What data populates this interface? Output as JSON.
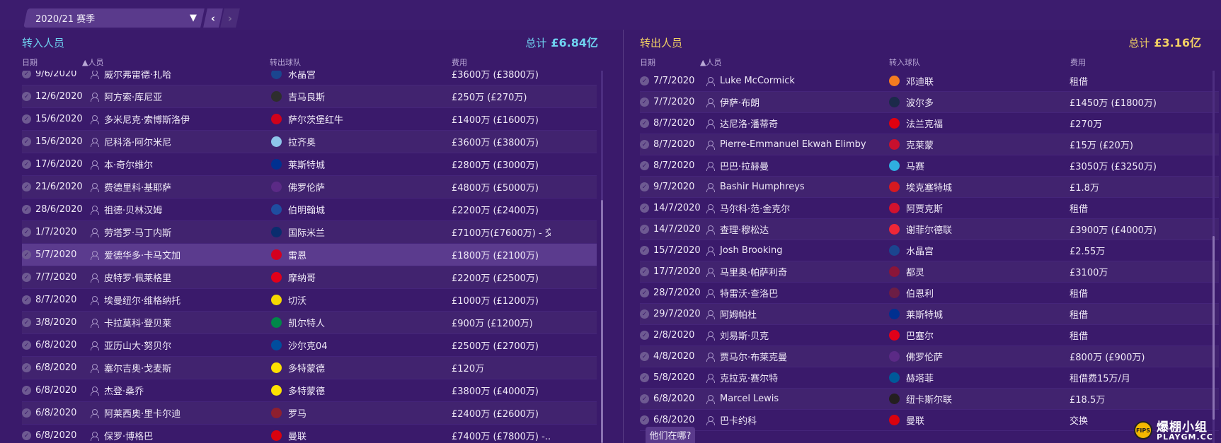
{
  "season": {
    "label": "2020/21 赛季"
  },
  "incoming": {
    "title": "转入人员",
    "total_label": "总计",
    "total_value": "£6.84亿",
    "columns": [
      "日期",
      "▲人员",
      "转出球队",
      "费用"
    ],
    "rows": [
      {
        "date": "9/6/2020",
        "person": "威尔弗雷德·扎哈",
        "club": "水晶宫",
        "fee": "£3600万 (£3800万)",
        "badge_color": "#1b458f"
      },
      {
        "date": "12/6/2020",
        "person": "阿方索·库尼亚",
        "club": "吉马良斯",
        "fee": "£250万 (£270万)",
        "badge_color": "#2e2e2e"
      },
      {
        "date": "15/6/2020",
        "person": "多米尼克·索博斯洛伊",
        "club": "萨尔茨堡红牛",
        "fee": "£1400万 (£1600万)",
        "badge_color": "#d0021b"
      },
      {
        "date": "15/6/2020",
        "person": "尼科洛·阿尔米尼",
        "club": "拉齐奥",
        "fee": "£3600万 (£3800万)",
        "badge_color": "#8ec5ea"
      },
      {
        "date": "17/6/2020",
        "person": "本·奇尔维尔",
        "club": "莱斯特城",
        "fee": "£2800万 (£3000万)",
        "badge_color": "#003090"
      },
      {
        "date": "21/6/2020",
        "person": "费德里科·基耶萨",
        "club": "佛罗伦萨",
        "fee": "£4800万 (£5000万)",
        "badge_color": "#5b2a86"
      },
      {
        "date": "28/6/2020",
        "person": "祖德·贝林汉姆",
        "club": "伯明翰城",
        "fee": "£2200万 (£2400万)",
        "badge_color": "#1f4da0"
      },
      {
        "date": "1/7/2020",
        "person": "劳塔罗·马丁内斯",
        "club": "国际米兰",
        "fee": "£7100万(£7600万) - 交...",
        "badge_color": "#0a2d6e"
      },
      {
        "date": "5/7/2020",
        "person": "爱德华多·卡马文加",
        "club": "雷恩",
        "fee": "£1800万 (£2100万)",
        "badge_color": "#d4001f"
      },
      {
        "date": "7/7/2020",
        "person": "皮特罗·佩莱格里",
        "club": "摩纳哥",
        "fee": "£2200万 (£2500万)",
        "badge_color": "#e2001a"
      },
      {
        "date": "8/7/2020",
        "person": "埃曼纽尔·维格纳托",
        "club": "切沃",
        "fee": "£1000万 (£1200万)",
        "badge_color": "#f5d800"
      },
      {
        "date": "3/8/2020",
        "person": "卡拉莫科·登贝莱",
        "club": "凯尔特人",
        "fee": "£900万 (£1200万)",
        "badge_color": "#018749"
      },
      {
        "date": "6/8/2020",
        "person": "亚历山大·努贝尔",
        "club": "沙尔克04",
        "fee": "£2500万 (£2700万)",
        "badge_color": "#004d9d"
      },
      {
        "date": "6/8/2020",
        "person": "塞尔吉奥·戈麦斯",
        "club": "多特蒙德",
        "fee": "£120万",
        "badge_color": "#fde100"
      },
      {
        "date": "6/8/2020",
        "person": "杰登·桑乔",
        "club": "多特蒙德",
        "fee": "£3800万 (£4000万)",
        "badge_color": "#fde100"
      },
      {
        "date": "6/8/2020",
        "person": "阿莱西奥·里卡尔迪",
        "club": "罗马",
        "fee": "£2400万 (£2600万)",
        "badge_color": "#8e1f2f"
      },
      {
        "date": "6/8/2020",
        "person": "保罗·博格巴",
        "club": "曼联",
        "fee": "£7400万 (£7800万) -...",
        "badge_color": "#da020e"
      }
    ]
  },
  "outgoing": {
    "title": "转出人员",
    "total_label": "总计",
    "total_value": "£3.16亿",
    "columns": [
      "日期",
      "▲人员",
      "转入球队",
      "费用"
    ],
    "rows": [
      {
        "date": "7/7/2020",
        "person": "Luke McCormick",
        "club": "邓迪联",
        "fee": "租借",
        "badge_color": "#f47c20"
      },
      {
        "date": "7/7/2020",
        "person": "伊萨·布朗",
        "club": "波尔多",
        "fee": "£1450万 (£1800万)",
        "badge_color": "#1b2a4a"
      },
      {
        "date": "8/7/2020",
        "person": "达尼洛·潘蒂奇",
        "club": "法兰克福",
        "fee": "£270万",
        "badge_color": "#e1000f"
      },
      {
        "date": "8/7/2020",
        "person": "Pierre-Emmanuel Ekwah Elimby",
        "club": "克莱蒙",
        "fee": "£15万 (£20万)",
        "badge_color": "#c8102e"
      },
      {
        "date": "8/7/2020",
        "person": "巴巴·拉赫曼",
        "club": "马赛",
        "fee": "£3050万 (£3250万)",
        "badge_color": "#2faee0"
      },
      {
        "date": "9/7/2020",
        "person": "Bashir Humphreys",
        "club": "埃克塞特城",
        "fee": "£1.8万",
        "badge_color": "#d71920"
      },
      {
        "date": "14/7/2020",
        "person": "马尔科·范·金克尔",
        "club": "阿贾克斯",
        "fee": "租借",
        "badge_color": "#d2122e"
      },
      {
        "date": "14/7/2020",
        "person": "查理·穆松达",
        "club": "谢菲尔德联",
        "fee": "£3900万 (£4000万)",
        "badge_color": "#ee2737"
      },
      {
        "date": "15/7/2020",
        "person": "Josh Brooking",
        "club": "水晶宫",
        "fee": "£2.55万",
        "badge_color": "#1b458f"
      },
      {
        "date": "17/7/2020",
        "person": "马里奥·帕萨利奇",
        "club": "都灵",
        "fee": "£3100万",
        "badge_color": "#8a1538"
      },
      {
        "date": "28/7/2020",
        "person": "特雷沃·查洛巴",
        "club": "伯恩利",
        "fee": "租借",
        "badge_color": "#6c1d45"
      },
      {
        "date": "29/7/2020",
        "person": "阿姆帕杜",
        "club": "莱斯特城",
        "fee": "租借",
        "badge_color": "#003090"
      },
      {
        "date": "2/8/2020",
        "person": "刘易斯·贝克",
        "club": "巴塞尔",
        "fee": "租借",
        "badge_color": "#e2001a"
      },
      {
        "date": "4/8/2020",
        "person": "贾马尔·布莱克曼",
        "club": "佛罗伦萨",
        "fee": "£800万 (£900万)",
        "badge_color": "#5b2a86"
      },
      {
        "date": "5/8/2020",
        "person": "克拉克·赛尔特",
        "club": "赫塔菲",
        "fee": "租借费15万/月",
        "badge_color": "#005999"
      },
      {
        "date": "6/8/2020",
        "person": "Marcel Lewis",
        "club": "纽卡斯尔联",
        "fee": "£18.5万",
        "badge_color": "#241f20"
      },
      {
        "date": "6/8/2020",
        "person": "巴卡约科",
        "club": "曼联",
        "fee": "交换",
        "badge_color": "#da020e"
      }
    ]
  },
  "where_button": "他们在哪?",
  "watermark": {
    "cn": "爆棚小组",
    "en": "PLAYGM.CC",
    "mark": "FIPS"
  }
}
